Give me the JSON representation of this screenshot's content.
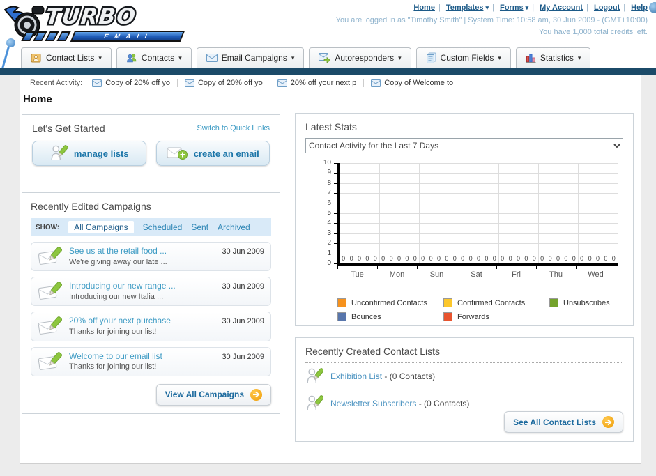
{
  "header": {
    "logo": {
      "title": "TURBO",
      "subtitle": "EMAIL"
    },
    "nav_links": [
      {
        "label": "Home",
        "dropdown": false
      },
      {
        "label": "Templates",
        "dropdown": true
      },
      {
        "label": "Forms",
        "dropdown": true
      },
      {
        "label": "My Account",
        "dropdown": false
      },
      {
        "label": "Logout",
        "dropdown": false
      },
      {
        "label": "Help",
        "dropdown": false
      }
    ],
    "login_line1": "You are logged in as \"Timothy Smith\" | System Time: 10:58 am, 30 Jun 2009 - (GMT+10:00)",
    "login_line2": "You have 1,000 total credits left."
  },
  "tabs": [
    {
      "label": "Contact Lists"
    },
    {
      "label": "Contacts"
    },
    {
      "label": "Email Campaigns"
    },
    {
      "label": "Autoresponders"
    },
    {
      "label": "Custom Fields"
    },
    {
      "label": "Statistics"
    }
  ],
  "recent_activity": {
    "label": "Recent Activity:",
    "items": [
      {
        "label": "Copy of 20% off yo"
      },
      {
        "label": "Copy of 20% off yo"
      },
      {
        "label": "20% off your next p"
      },
      {
        "label": "Copy of Welcome to"
      }
    ]
  },
  "page_title": "Home",
  "get_started": {
    "title": "Let's Get Started",
    "switch_link": "Switch to Quick Links",
    "buttons": [
      {
        "label": "manage lists"
      },
      {
        "label": "create an email"
      }
    ]
  },
  "campaigns": {
    "title": "Recently Edited Campaigns",
    "show_label": "SHOW:",
    "filters": [
      "All Campaigns",
      "Scheduled",
      "Sent",
      "Archived"
    ],
    "active_filter": "All Campaigns",
    "items": [
      {
        "title": "See us at the retail food ...",
        "subtitle": "We're giving away our late ...",
        "date": "30 Jun 2009"
      },
      {
        "title": "Introducing our new range ...",
        "subtitle": "Introducing our new Italia ...",
        "date": "30 Jun 2009"
      },
      {
        "title": "20% off your next purchase",
        "subtitle": "Thanks for joining our list!",
        "date": "30 Jun 2009"
      },
      {
        "title": "Welcome to our email list",
        "subtitle": "Thanks for joining our list!",
        "date": "30 Jun 2009"
      }
    ],
    "view_all_label": "View All Campaigns"
  },
  "stats": {
    "title": "Latest Stats",
    "selected_option": "Contact Activity for the Last 7 Days"
  },
  "chart_data": {
    "type": "bar",
    "title": "Contact Activity for the Last 7 Days",
    "categories": [
      "Tue",
      "Mon",
      "Sun",
      "Sat",
      "Fri",
      "Thu",
      "Wed"
    ],
    "series": [
      {
        "name": "Unconfirmed Contacts",
        "color": "#F6921E",
        "values": [
          0,
          0,
          0,
          0,
          0,
          0,
          0
        ]
      },
      {
        "name": "Confirmed Contacts",
        "color": "#FCC72C",
        "values": [
          0,
          0,
          0,
          0,
          0,
          0,
          0
        ]
      },
      {
        "name": "Unsubscribes",
        "color": "#74A32C",
        "values": [
          0,
          0,
          0,
          0,
          0,
          0,
          0
        ]
      },
      {
        "name": "Bounces",
        "color": "#5876AC",
        "values": [
          0,
          0,
          0,
          0,
          0,
          0,
          0
        ]
      },
      {
        "name": "Forwards",
        "color": "#E8542F",
        "values": [
          0,
          0,
          0,
          0,
          0,
          0,
          0
        ]
      }
    ],
    "ylim": [
      0,
      10
    ],
    "yticks": [
      0,
      1,
      2,
      3,
      4,
      5,
      6,
      7,
      8,
      9,
      10
    ],
    "grid": true,
    "legend_position": "bottom",
    "value_labels": "every series shows 0 above the baseline for each day"
  },
  "contact_lists": {
    "title": "Recently Created Contact Lists",
    "items": [
      {
        "name": "Exhibition List",
        "suffix": "- (0 Contacts)"
      },
      {
        "name": "Newsletter Subscribers",
        "suffix": "- (0 Contacts)"
      }
    ],
    "see_all_label": "See All Contact Lists"
  },
  "colors": {
    "navy_bar": "#1b4a68",
    "link_dark_blue": "#1c5a88",
    "link_light_blue": "#3d9bc4",
    "show_bar_bg": "#d9eaf8",
    "arrow_button_orange": "#f0a00c"
  }
}
